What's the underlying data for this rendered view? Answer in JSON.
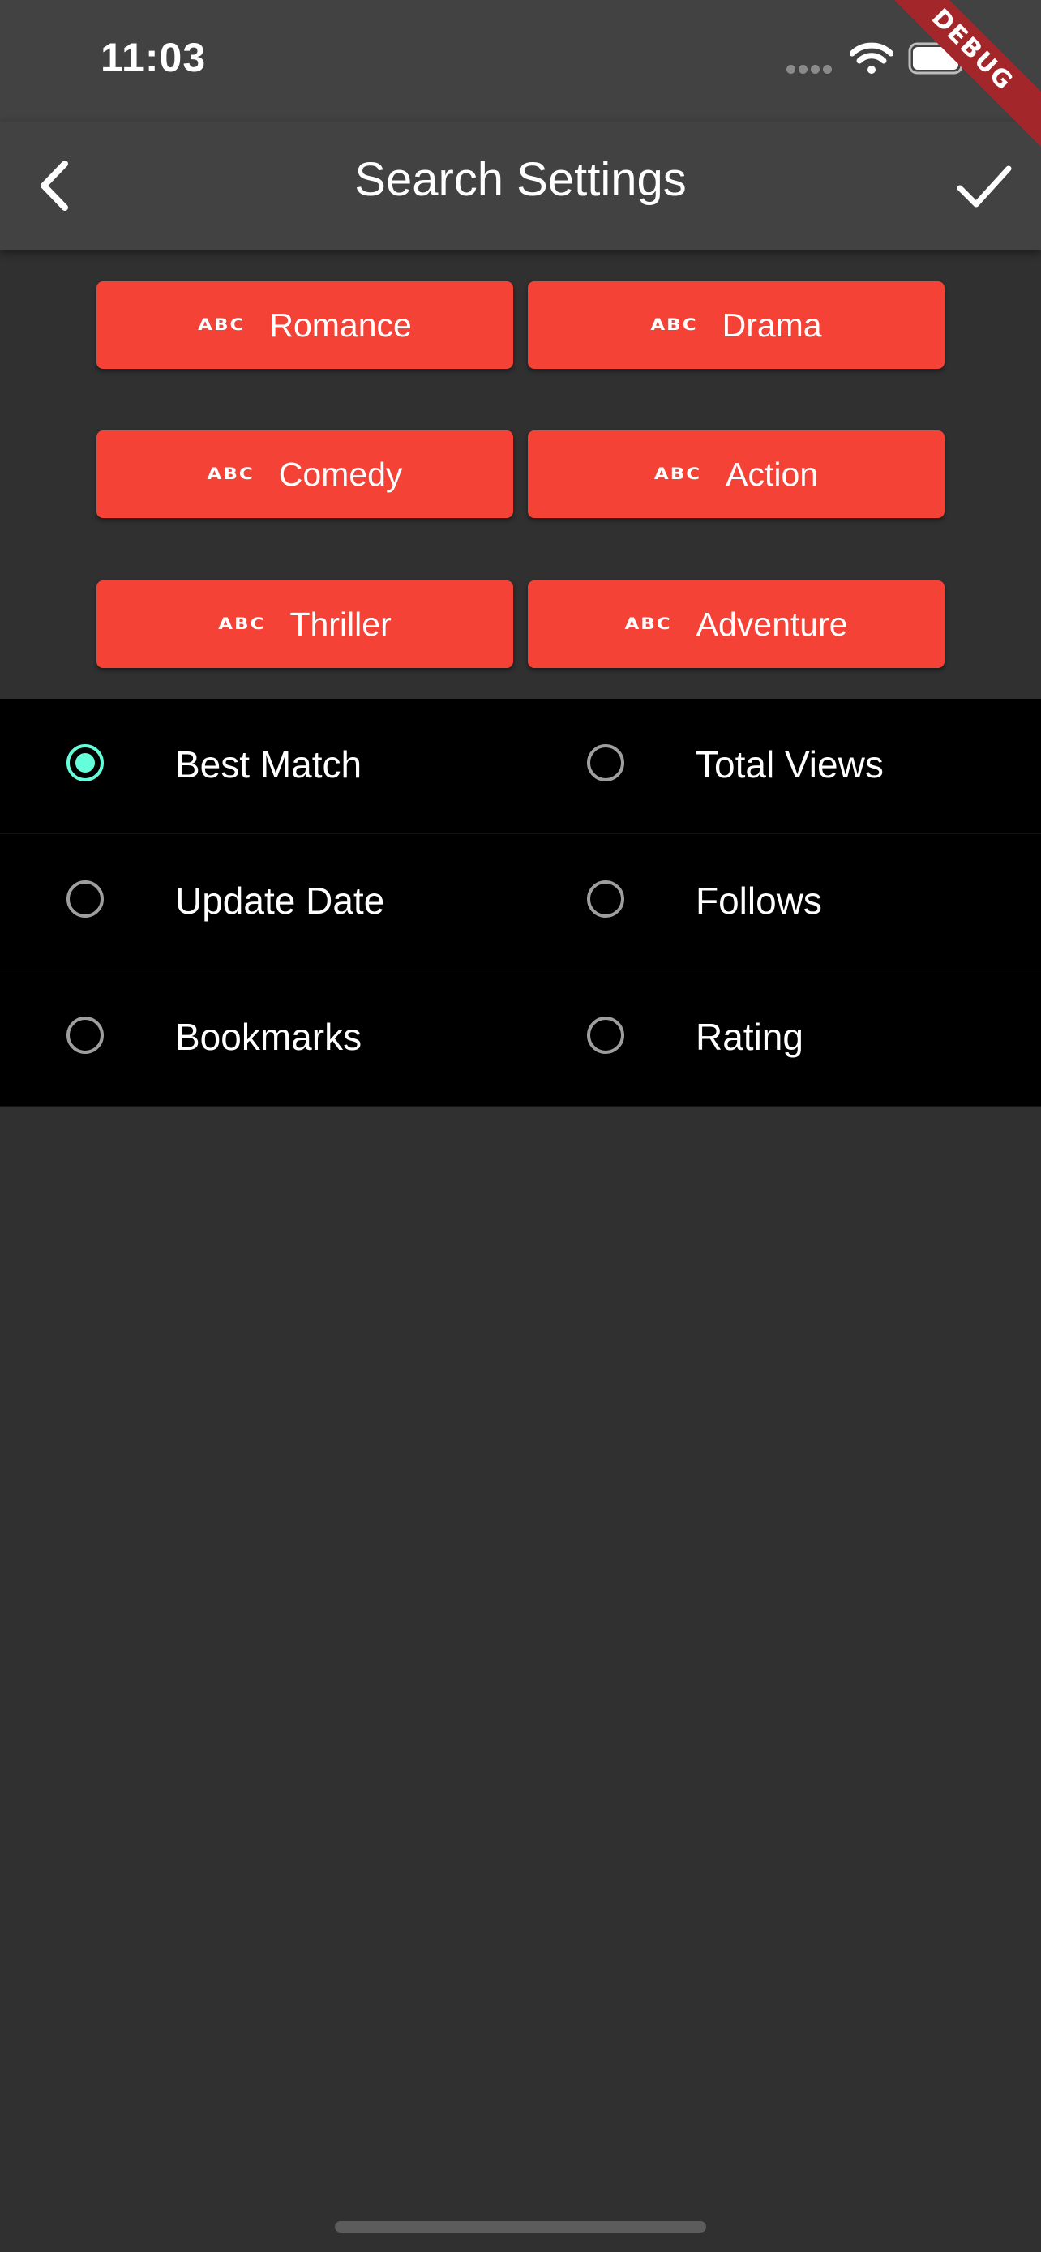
{
  "status_bar": {
    "time": "11:03"
  },
  "debug_banner": "DEBUG",
  "app_bar": {
    "title": "Search Settings"
  },
  "genres": [
    {
      "label": "Romance",
      "icon": "abc-icon",
      "icon_text": "ABC"
    },
    {
      "label": "Drama",
      "icon": "abc-icon",
      "icon_text": "ABC"
    },
    {
      "label": "Comedy",
      "icon": "abc-icon",
      "icon_text": "ABC"
    },
    {
      "label": "Action",
      "icon": "abc-icon",
      "icon_text": "ABC"
    },
    {
      "label": "Thriller",
      "icon": "abc-icon",
      "icon_text": "ABC"
    },
    {
      "label": "Adventure",
      "icon": "abc-icon",
      "icon_text": "ABC"
    }
  ],
  "sort_options": [
    {
      "label": "Best Match",
      "selected": true
    },
    {
      "label": "Total Views",
      "selected": false
    },
    {
      "label": "Update Date",
      "selected": false
    },
    {
      "label": "Follows",
      "selected": false
    },
    {
      "label": "Bookmarks",
      "selected": false
    },
    {
      "label": "Rating",
      "selected": false
    }
  ],
  "colors": {
    "app_bar": "#424242",
    "background": "#303030",
    "chip": "#f44336",
    "radio_selected": "#64ffda",
    "radio_unselected": "#9e9e9e",
    "debug_banner": "#a3262a"
  }
}
